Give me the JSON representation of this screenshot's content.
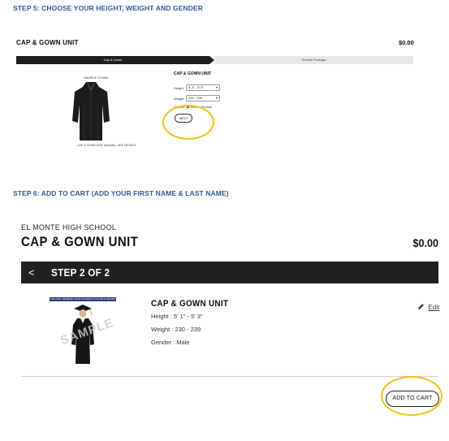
{
  "step5": {
    "heading": "STEP 5: CHOOSE YOUR HEIGHT, WEIGHT AND GENDER",
    "title": "CAP & GOWN UNIT",
    "price": "$0.00",
    "progress": {
      "active_label": "Cap & Gown",
      "next_label": "Review Package"
    },
    "image_caption_top": "SAMPLE GOWN",
    "image_caption_bottom": "CAP & GOWN UNIT (Sample) - SEE DETAILS",
    "form_title": "CAP & GOWN UNIT",
    "height_label": "Height:",
    "height_value": "5' 3\" - 5' 5\"",
    "weight_label": "Weight:",
    "weight_value": "220 - 229",
    "gender_label": "Gender:",
    "gender_options": [
      "Male",
      "Female"
    ],
    "gender_selected": "Male",
    "next_label": "NEXT"
  },
  "step6": {
    "heading": "STEP 6: ADD TO CART (ADD YOUR FIRST NAME & LAST NAME)",
    "school": "EL MONTE HIGH SCHOOL",
    "title": "CAP & GOWN UNIT",
    "price": "$0.00",
    "back_glyph": "<",
    "step_text": "STEP 2 OF 2",
    "image_banner": "YOU WILL RECEIVE YOUR SCHOOL'S COLOR & DESIGN",
    "image_watermark": "SAMPLE",
    "product_name": "CAP & GOWN UNIT",
    "height_line": "Height : 5' 1\" - 5' 3\"",
    "weight_line": "Weight : 230 - 239",
    "gender_line": "Gender : Male",
    "edit_label": "Edit",
    "add_to_cart_label": "ADD TO CART"
  },
  "colors": {
    "heading_blue": "#2f5a9e",
    "highlight_yellow": "#f2c21b",
    "dark_bar": "#202020"
  },
  "icons": [
    "pencil-icon",
    "chevron-left-icon",
    "gown-image"
  ]
}
